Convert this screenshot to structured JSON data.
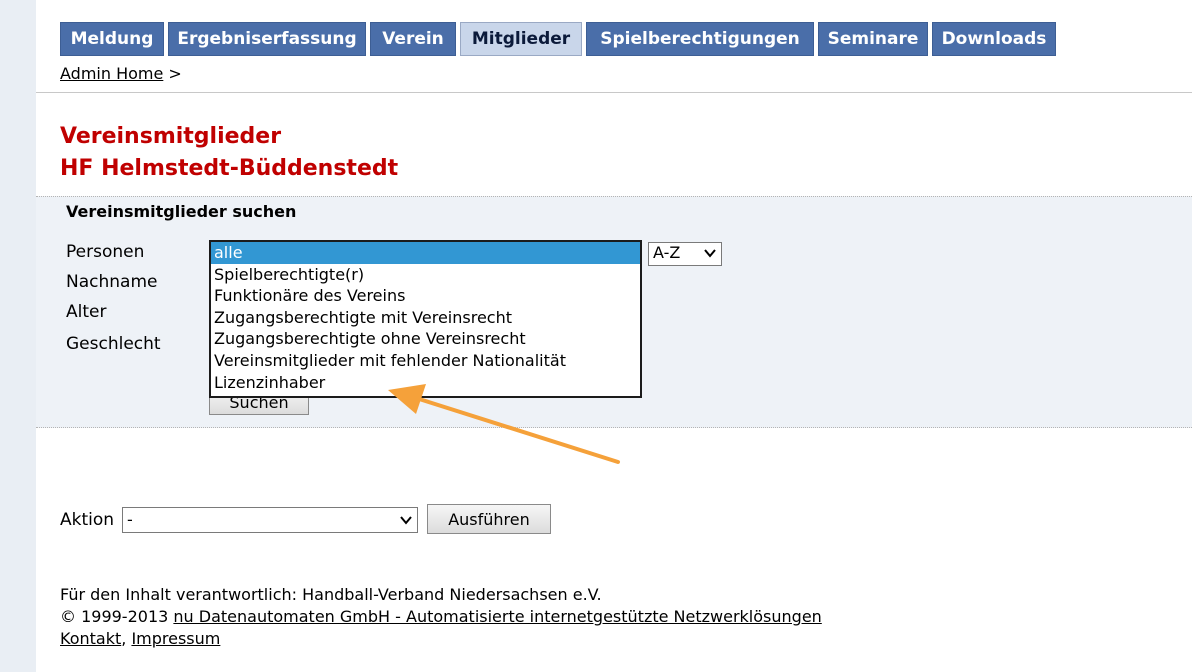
{
  "nav": {
    "tabs": [
      {
        "label": "Meldung",
        "active": false
      },
      {
        "label": "Ergebniserfassung",
        "active": false
      },
      {
        "label": "Verein",
        "active": false
      },
      {
        "label": "Mitglieder",
        "active": true
      },
      {
        "label": "Spielberechtigungen",
        "active": false
      },
      {
        "label": "Seminare",
        "active": false
      },
      {
        "label": "Downloads",
        "active": false
      }
    ]
  },
  "breadcrumb": {
    "link": "Admin Home",
    "separator": ">"
  },
  "page": {
    "title": "Vereinsmitglieder",
    "subtitle": "HF Helmstedt-Büddenstedt"
  },
  "search": {
    "heading": "Vereinsmitglieder suchen",
    "labels": {
      "personen": "Personen",
      "nachname": "Nachname",
      "alter": "Alter",
      "geschlecht": "Geschlecht"
    },
    "personen_options": [
      "alle",
      "Spielberechtigte(r)",
      "Funktionäre des Vereins",
      "Zugangsberechtigte mit Vereinsrecht",
      "Zugangsberechtigte ohne Vereinsrecht",
      "Vereinsmitglieder mit fehlender Nationalität",
      "Lizenzinhaber"
    ],
    "selected_index": 0,
    "sort_value": "A-Z",
    "submit_label": "Suchen"
  },
  "action": {
    "label": "Aktion",
    "select_value": "-",
    "execute_label": "Ausführen"
  },
  "footer": {
    "responsible": "Für den Inhalt verantwortlich: Handball-Verband Niedersachsen e.V.",
    "copyright_prefix": "© 1999-2013 ",
    "copyright_link": "nu Datenautomaten GmbH - Automatisierte internetgestützte Netzwerklösungen",
    "kontakt": "Kontakt",
    "comma": ",",
    "impressum": "Impressum"
  },
  "colors": {
    "tab_bg": "#4a6ea9",
    "tab_active_bg": "#c9d6ea",
    "title_red": "#c00000",
    "selected_option": "#3297d3",
    "annotation_arrow": "#f5a13a"
  }
}
